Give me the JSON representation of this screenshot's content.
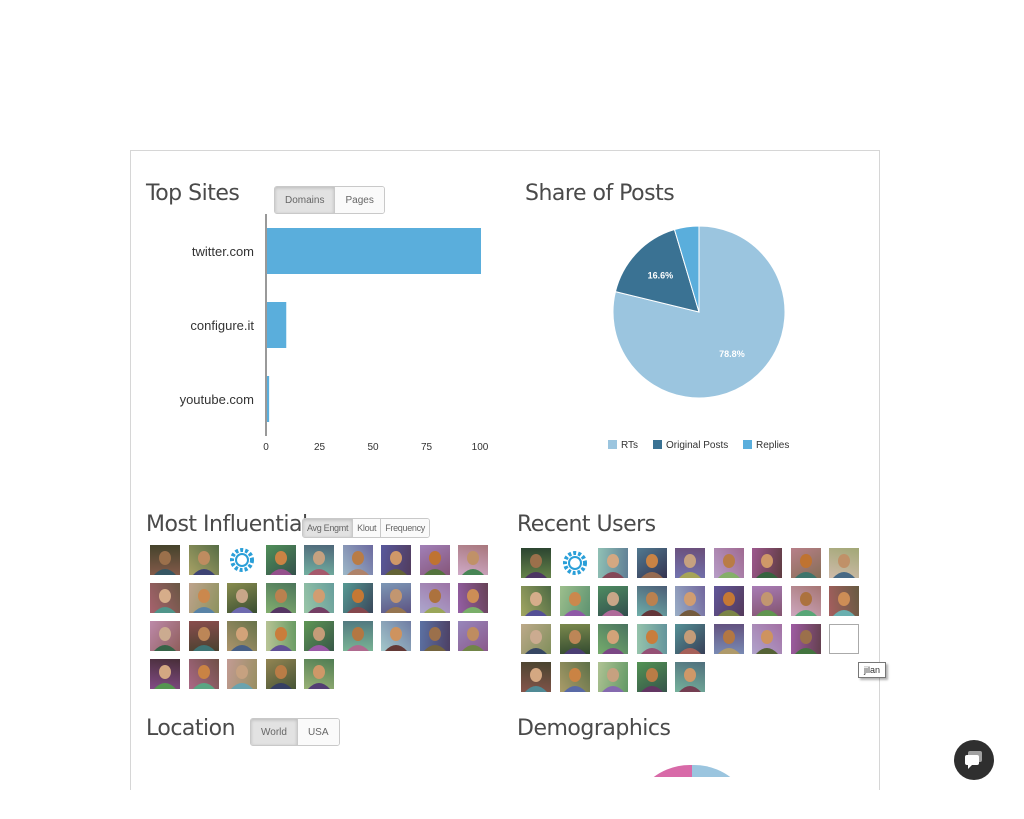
{
  "top_sites": {
    "title": "Top Sites",
    "tabs": [
      {
        "label": "Domains",
        "active": true
      },
      {
        "label": "Pages",
        "active": false
      }
    ],
    "bar_color": "#5aaedc"
  },
  "share_of_posts": {
    "title": "Share of Posts",
    "colors": {
      "rts": "#9bc5df",
      "original_posts": "#3a7293",
      "replies": "#5aaedc"
    }
  },
  "most_influential": {
    "title": "Most Influential",
    "tabs": [
      {
        "label": "Avg Engmt",
        "active": true
      },
      {
        "label": "Klout",
        "active": false
      },
      {
        "label": "Frequency",
        "active": false
      }
    ]
  },
  "recent_users": {
    "title": "Recent Users",
    "tooltip": "jilan"
  },
  "location": {
    "title": "Location",
    "tabs": [
      {
        "label": "World",
        "active": true
      },
      {
        "label": "USA",
        "active": false
      }
    ]
  },
  "demographics": {
    "title": "Demographics",
    "colors": {
      "female": "#d86aa8",
      "male": "#9bc5df"
    }
  },
  "chart_data": [
    {
      "type": "bar",
      "orientation": "horizontal",
      "categories": [
        "twitter.com",
        "configure.it",
        "youtube.com"
      ],
      "values": [
        100,
        9,
        1
      ],
      "xlim": [
        0,
        100
      ],
      "xticks": [
        "0",
        "25",
        "50",
        "75",
        "100"
      ],
      "grid": false
    },
    {
      "type": "pie",
      "labels": [
        "RTs",
        "Original Posts",
        "Replies"
      ],
      "values": [
        78.8,
        16.6,
        4.6
      ],
      "data_labels": [
        "78.8%",
        "16.6%",
        ""
      ],
      "legend": [
        "RTs",
        "Original Posts",
        "Replies"
      ],
      "legend_position": "bottom"
    }
  ],
  "icons": {
    "chat": "chat-bubble-icon"
  }
}
